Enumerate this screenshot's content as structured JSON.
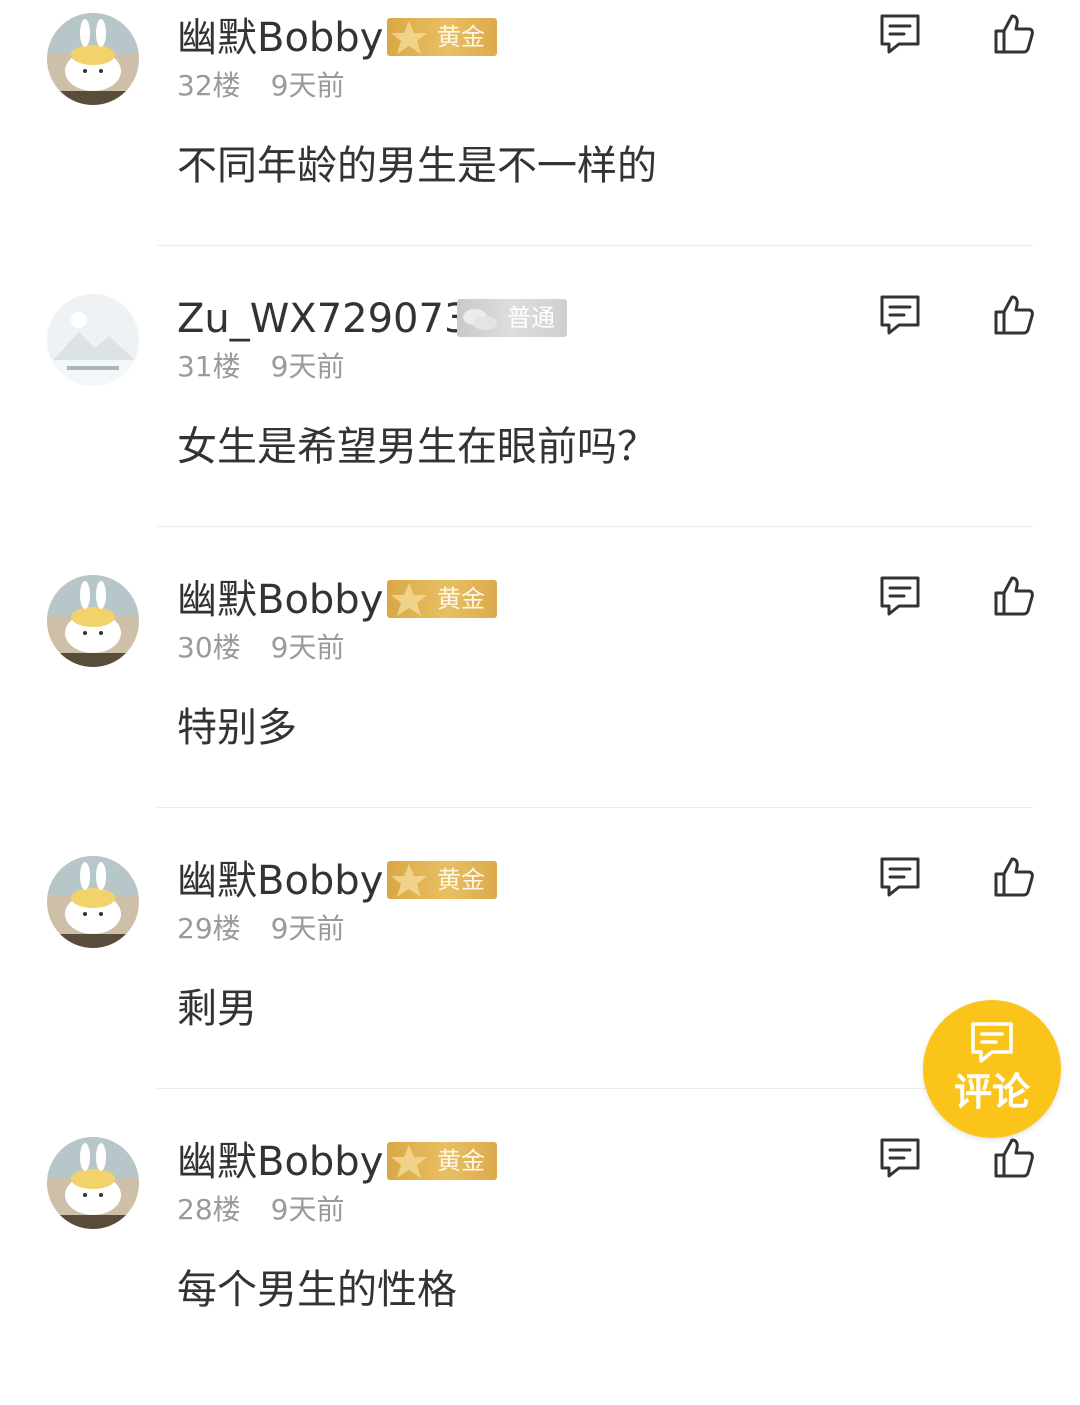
{
  "comments": [
    {
      "username": "幽默Bobby",
      "badge": "黄金",
      "badge_type": "gold",
      "floor": "32楼",
      "time": "9天前",
      "content": "不同年龄的男生是不一样的",
      "avatar": "bunny-avatar"
    },
    {
      "username": "Zu_WX729073",
      "badge": "普通",
      "badge_type": "normal",
      "floor": "31楼",
      "time": "9天前",
      "content": "女生是希望男生在眼前吗？",
      "avatar": "default-avatar"
    },
    {
      "username": "幽默Bobby",
      "badge": "黄金",
      "badge_type": "gold",
      "floor": "30楼",
      "time": "9天前",
      "content": "特别多",
      "avatar": "bunny-avatar"
    },
    {
      "username": "幽默Bobby",
      "badge": "黄金",
      "badge_type": "gold",
      "floor": "29楼",
      "time": "9天前",
      "content": "剩男",
      "avatar": "bunny-avatar"
    },
    {
      "username": "幽默Bobby",
      "badge": "黄金",
      "badge_type": "gold",
      "floor": "28楼",
      "time": "9天前",
      "content": "每个男生的性格",
      "avatar": "bunny-avatar"
    }
  ],
  "fab": {
    "label": "评论",
    "icon": "comment-icon"
  },
  "icons": {
    "reply": "reply-icon",
    "like": "thumbs-up-icon",
    "badge_star": "star-icon"
  },
  "colors": {
    "gold_badge": "#e0b252",
    "normal_badge": "#d4d4d4",
    "fab": "#fbc41a",
    "meta_text": "#9a9a9a",
    "main_text": "#333333"
  }
}
